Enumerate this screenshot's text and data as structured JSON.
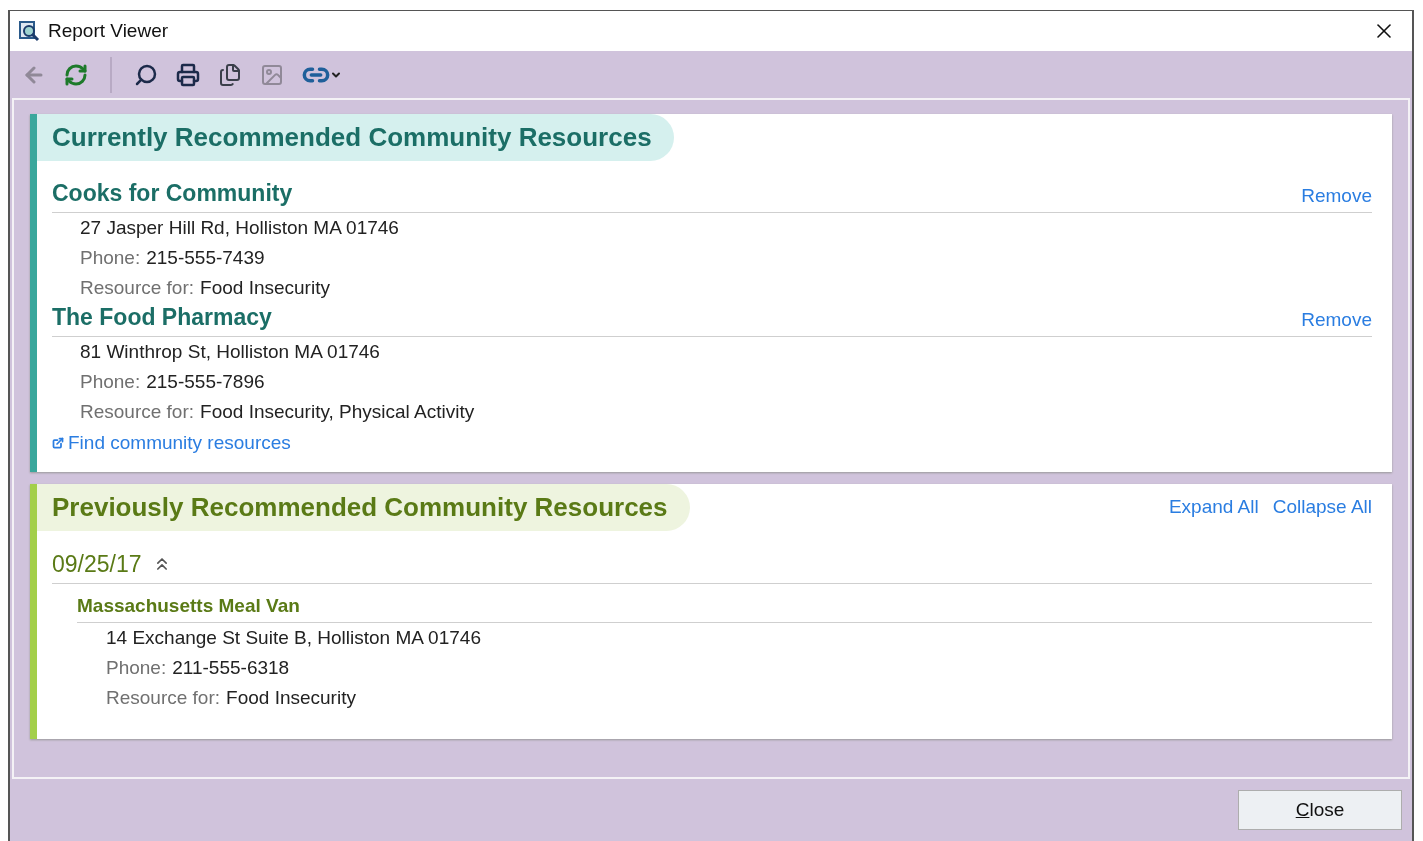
{
  "window": {
    "title": "Report Viewer"
  },
  "toolbar": [
    {
      "kind": "back",
      "disabled": true
    },
    {
      "kind": "refresh",
      "disabled": false
    },
    {
      "kind": "separator"
    },
    {
      "kind": "find",
      "disabled": false
    },
    {
      "kind": "print",
      "disabled": false
    },
    {
      "kind": "copy",
      "disabled": false
    },
    {
      "kind": "image",
      "disabled": true
    },
    {
      "kind": "link",
      "disabled": false
    }
  ],
  "current": {
    "title": "Currently Recommended Community Resources",
    "resources": [
      {
        "name": "Cooks for Community",
        "remove": "Remove",
        "address": "27 Jasper Hill Rd, Holliston MA 01746",
        "phone_label": "Phone:",
        "phone": "215-555-7439",
        "for_label": "Resource for:",
        "for": "Food Insecurity"
      },
      {
        "name": "The Food Pharmacy",
        "remove": "Remove",
        "address": "81 Winthrop St, Holliston MA 01746",
        "phone_label": "Phone:",
        "phone": "215-555-7896",
        "for_label": "Resource for:",
        "for": "Food Insecurity, Physical Activity"
      }
    ],
    "find_link": "Find community resources"
  },
  "previous": {
    "title": "Previously Recommended Community Resources",
    "expand_all": "Expand All",
    "collapse_all": "Collapse All",
    "groups": [
      {
        "date": "09/25/17",
        "expanded": true,
        "resources": [
          {
            "name": "Massachusetts Meal Van",
            "address": "14 Exchange St Suite B, Holliston MA 01746",
            "phone_label": "Phone:",
            "phone": "211-555-6318",
            "for_label": "Resource for:",
            "for": "Food Insecurity"
          }
        ]
      }
    ]
  },
  "footer": {
    "close_button": {
      "label": "Close"
    }
  }
}
